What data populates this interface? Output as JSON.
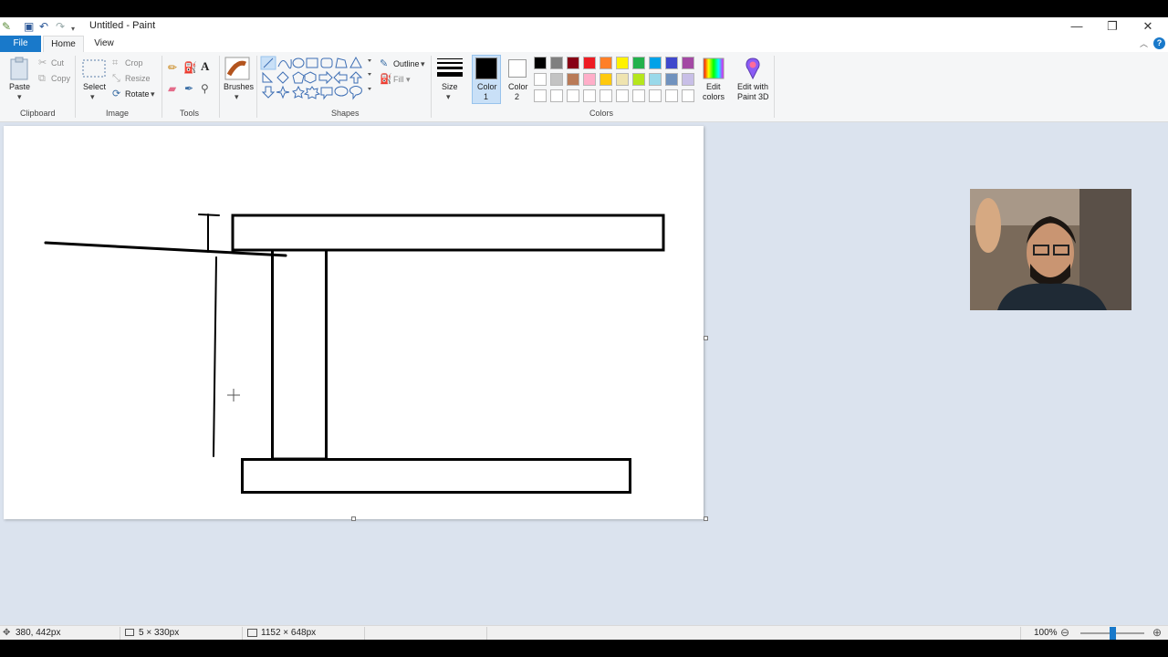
{
  "window": {
    "title": "Untitled - Paint",
    "controls": {
      "minimize": "—",
      "restore": "❐",
      "close": "✕"
    }
  },
  "ribbon_tabs": {
    "file": "File",
    "home": "Home",
    "view": "View"
  },
  "clipboard": {
    "paste": "Paste",
    "cut": "Cut",
    "copy": "Copy",
    "group": "Clipboard"
  },
  "image": {
    "select": "Select",
    "crop": "Crop",
    "resize": "Resize",
    "rotate": "Rotate",
    "group": "Image"
  },
  "tools": {
    "group": "Tools"
  },
  "brushes": {
    "label": "Brushes"
  },
  "shapes": {
    "outline": "Outline",
    "fill": "Fill",
    "group": "Shapes"
  },
  "size": {
    "label": "Size"
  },
  "colors": {
    "color1_line1": "Color",
    "color1_line2": "1",
    "color2_line1": "Color",
    "color2_line2": "2",
    "edit_line1": "Edit",
    "edit_line2": "colors",
    "paint3d_line1": "Edit with",
    "paint3d_line2": "Paint 3D",
    "group": "Colors",
    "palette_row1": [
      "#000000",
      "#7f7f7f",
      "#880015",
      "#ed1c24",
      "#ff7f27",
      "#fff200",
      "#22b14c",
      "#00a2e8",
      "#3f48cc",
      "#a349a4"
    ],
    "palette_row2": [
      "#ffffff",
      "#c3c3c3",
      "#b97a57",
      "#ffaec9",
      "#ffc90e",
      "#efe4b0",
      "#b5e61d",
      "#99d9ea",
      "#7092be",
      "#c8bfe7"
    ]
  },
  "status": {
    "cursor_pos": "380, 442px",
    "selection_size": "5 × 330px",
    "image_size": "1152 × 648px",
    "zoom": "100%"
  }
}
